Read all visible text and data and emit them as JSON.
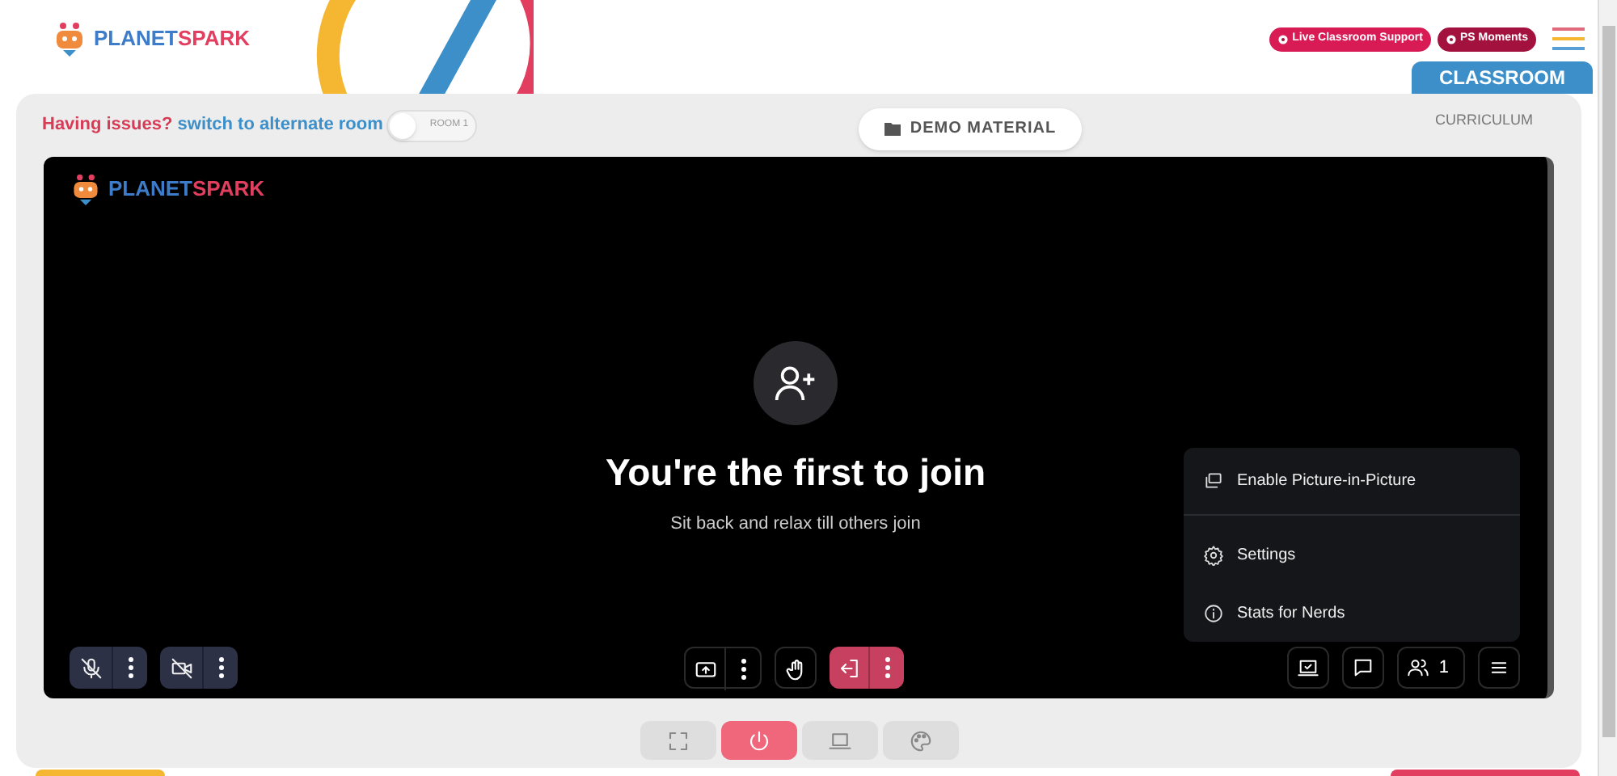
{
  "header": {
    "logo": {
      "part_1": "PLANET",
      "part_2": "SPARK"
    },
    "buttons": [
      {
        "label": "Live Classroom Support",
        "color": "#d81b55"
      },
      {
        "label": "PS Moments",
        "color": "#a3123f"
      }
    ]
  },
  "tabs": [
    {
      "label": "CLASSROOM",
      "selected": true
    },
    {
      "label": "CURRICULUM",
      "selected": false
    }
  ],
  "notice": {
    "text": "Having issues?",
    "link": "switch to alternate room"
  },
  "room_switch": {
    "label": "ROOM 1",
    "on": false
  },
  "demo_button": {
    "label": "DEMO MATERIAL"
  },
  "video": {
    "logo": {
      "part_1": "PLANET",
      "part_2": "SPARK"
    },
    "title": "You're the first to join",
    "subtitle": "Sit back and relax till others join"
  },
  "menu": [
    {
      "kind": "pip",
      "label": "Enable Picture-in-Picture"
    },
    {
      "kind": "settings",
      "label": "Settings"
    },
    {
      "kind": "info",
      "label": "Stats for Nerds"
    }
  ],
  "left_controls": [
    {
      "kind": "mic",
      "off": true
    },
    {
      "kind": "camera",
      "off": true
    }
  ],
  "center_controls": [
    {
      "kind": "share",
      "has_menu": true,
      "danger": false
    },
    {
      "kind": "hand",
      "has_menu": false,
      "danger": false
    },
    {
      "kind": "leave",
      "has_menu": true,
      "danger": true
    }
  ],
  "right_controls": [
    {
      "kind": "whiteboard"
    },
    {
      "kind": "chat"
    },
    {
      "kind": "people",
      "count": "1"
    },
    {
      "kind": "menu"
    }
  ],
  "bottom_bar": [
    {
      "kind": "fullscreen",
      "active": false
    },
    {
      "kind": "power",
      "active": true
    },
    {
      "kind": "laptop",
      "active": false
    },
    {
      "kind": "palette",
      "active": false
    }
  ]
}
